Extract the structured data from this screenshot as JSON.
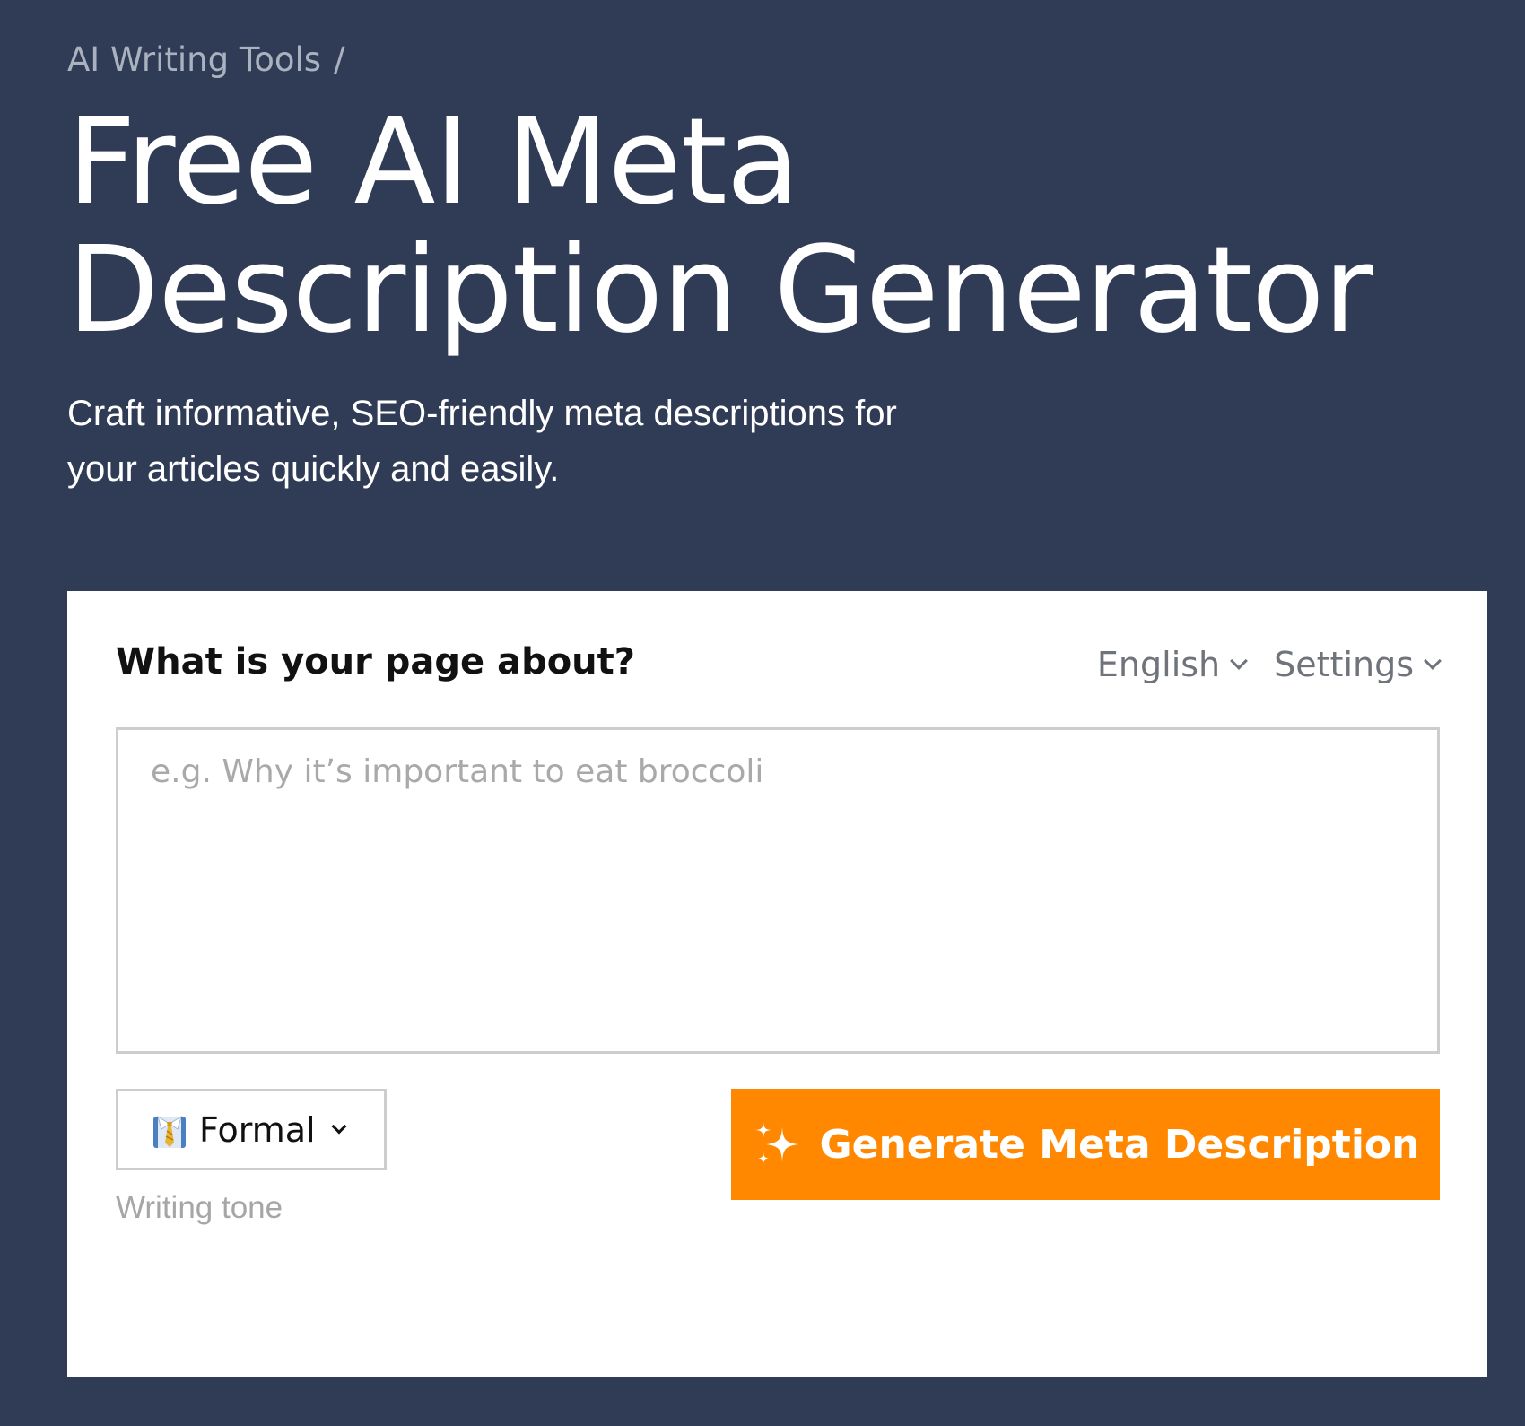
{
  "breadcrumb": {
    "parent": "AI Writing Tools",
    "separator": "/"
  },
  "page": {
    "title_line1": "Free AI Meta",
    "title_line2": "Description Generator",
    "subtitle_line1": "Craft informative, SEO-friendly meta descriptions for",
    "subtitle_line2": "your articles quickly and easily."
  },
  "form": {
    "question": "What is your page about?",
    "language_label": "English",
    "settings_label": "Settings",
    "topic_value": "",
    "topic_placeholder": "e.g. Why it’s important to eat broccoli",
    "tone_value": "Formal",
    "tone_icon": "necktie-shirt-icon",
    "tone_caption": "Writing tone",
    "generate_label": "Generate Meta Description",
    "generate_icon": "sparkles-icon"
  },
  "colors": {
    "background": "#303c56",
    "card": "#ffffff",
    "accent": "#ff8800",
    "muted_text": "#aab2c0",
    "border": "#cdcdcd"
  }
}
